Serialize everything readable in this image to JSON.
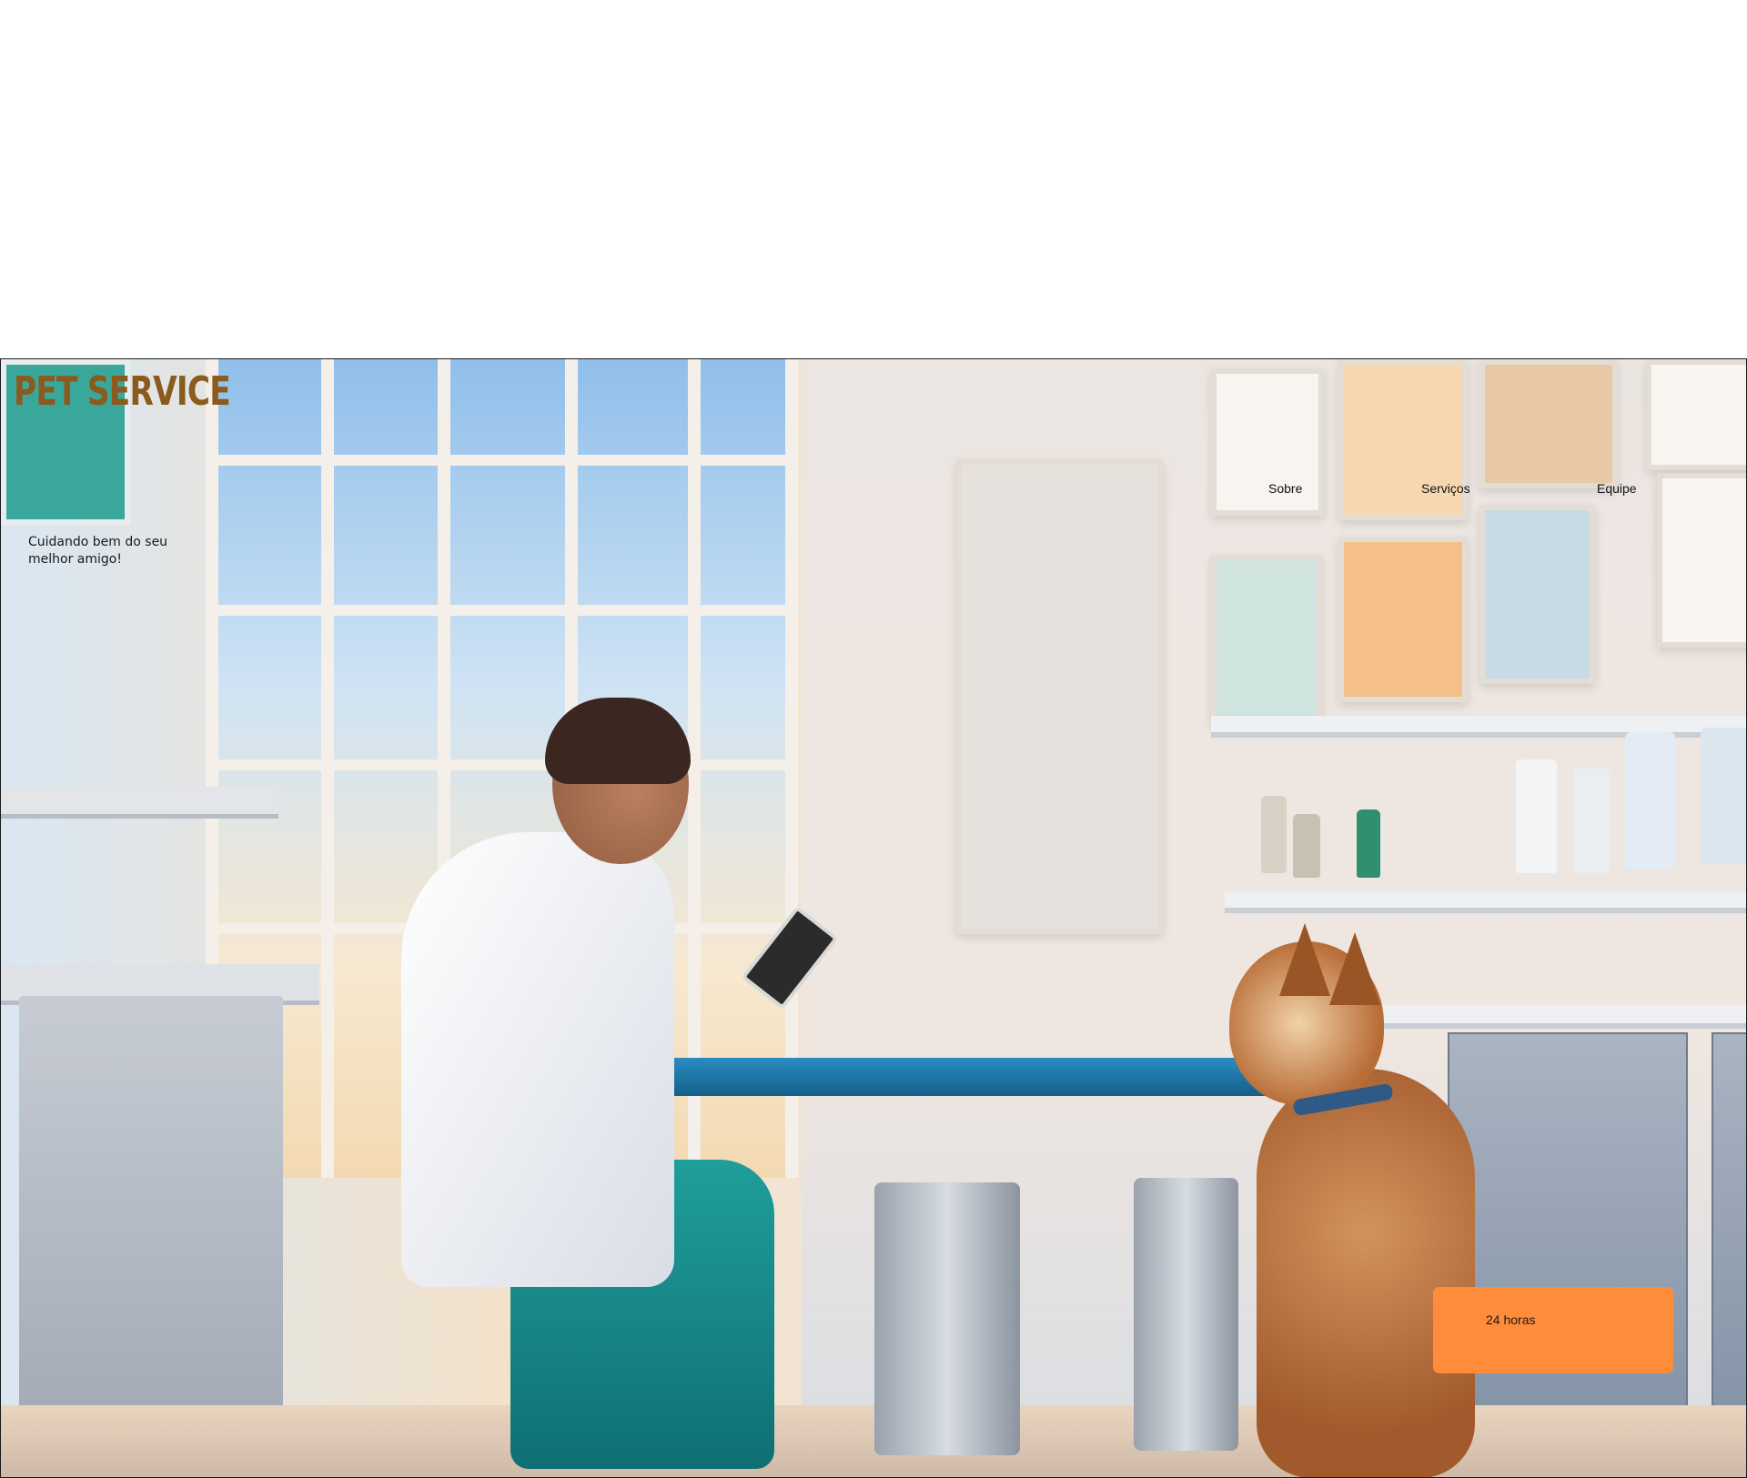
{
  "brand": {
    "logo_text": "PET SERVICE",
    "logo_color": "#8a5a1e"
  },
  "hero": {
    "tagline": "Cuidando bem do seu melhor amigo!",
    "cta_label": "24 horas",
    "cta_color": "#ff8c3a"
  },
  "nav": {
    "items": [
      {
        "label": "Sobre"
      },
      {
        "label": "Serviços"
      },
      {
        "label": "Equipe"
      }
    ]
  }
}
